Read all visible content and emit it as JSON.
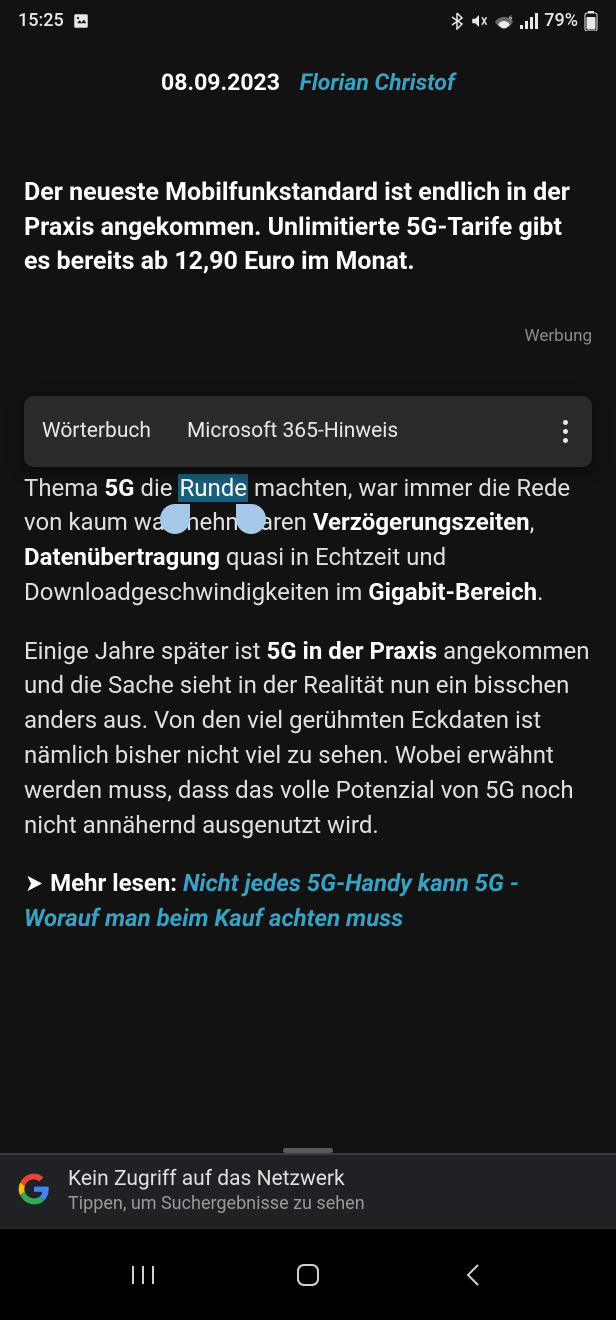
{
  "status": {
    "time": "15:25",
    "battery_pct": "79%"
  },
  "article": {
    "date": "08.09.2023",
    "author": "Florian Christof",
    "lead": "Der neueste Mobilfunkstandard ist endlich in der Praxis angekommen. Unlimitierte 5G-Tarife gibt es bereits ab 12,90 Euro im Monat.",
    "ad_label": "Werbung",
    "selection_word": "Runde",
    "para1_prefix": "Thema ",
    "para1_b1": "5G",
    "para1_mid1": " die ",
    "para1_mid2": " machten, war immer die Rede von kaum wahrnehmbaren ",
    "para1_b2": "Verzögerungszeiten",
    "para1_sep": ", ",
    "para1_b3": "Datenübertragung",
    "para1_mid3": " quasi in Echtzeit und Downloadgeschwindigkeiten im ",
    "para1_b4": "Gigabit-Bereich",
    "para1_end": ".",
    "para2_a": "Einige Jahre später ist ",
    "para2_b1": "5G in der Praxis",
    "para2_b": " angekommen und die Sache sieht in der Realität nun ein bisschen anders aus. Von den viel gerühmten Eckdaten ist nämlich bisher nicht viel zu sehen. Wobei erwähnt werden muss, dass das volle Potenzial von 5G noch nicht annähernd ausgenutzt wird.",
    "more_label": "Mehr lesen:",
    "more_target": "Nicht jedes 5G-Handy kann 5G - Worauf man beim Kauf achten muss"
  },
  "context_menu": {
    "item1": "Wörterbuch",
    "item2": "Microsoft 365-Hinweis"
  },
  "sheet": {
    "primary": "Kein Zugriff auf das Netzwerk",
    "secondary": "Tippen, um Suchergebnisse zu sehen"
  }
}
